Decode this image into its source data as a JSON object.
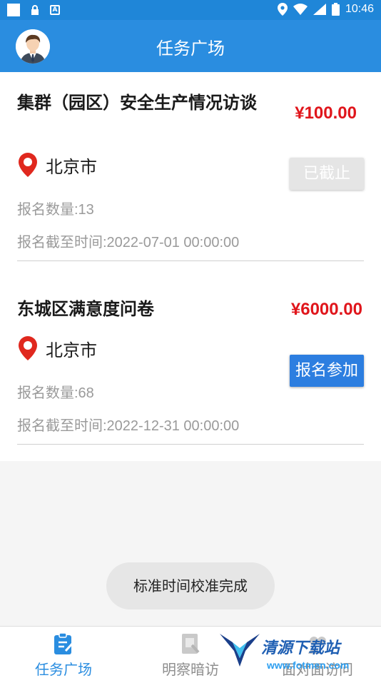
{
  "status_bar": {
    "time": "10:46"
  },
  "header": {
    "title": "任务广场"
  },
  "tasks": [
    {
      "title": "集群（园区）安全生产情况访谈",
      "price": "¥100.00",
      "location": "北京市",
      "signup_count": "报名数量:13",
      "deadline": "报名截至时间:2022-07-01 00:00:00",
      "button": "已截止"
    },
    {
      "title": "东城区满意度问卷",
      "price": "¥6000.00",
      "location": "北京市",
      "signup_count": "报名数量:68",
      "deadline": "报名截至时间:2022-12-31 00:00:00",
      "button": "报名参加"
    }
  ],
  "toast": "标准时间校准完成",
  "tabbar": {
    "items": [
      {
        "label": "任务广场",
        "icon": "task-square-icon",
        "active": true
      },
      {
        "label": "明察暗访",
        "icon": "inspection-icon",
        "active": false
      },
      {
        "label": "面对面访问",
        "icon": "interview-icon",
        "active": false
      }
    ]
  },
  "watermark": {
    "text": "清源下载站",
    "url": "www.fotmen.com"
  },
  "colors": {
    "primary": "#2a8de0",
    "price": "#e0151b",
    "active_tab": "#2a8de0",
    "inactive_tab": "#8e8e8e"
  }
}
